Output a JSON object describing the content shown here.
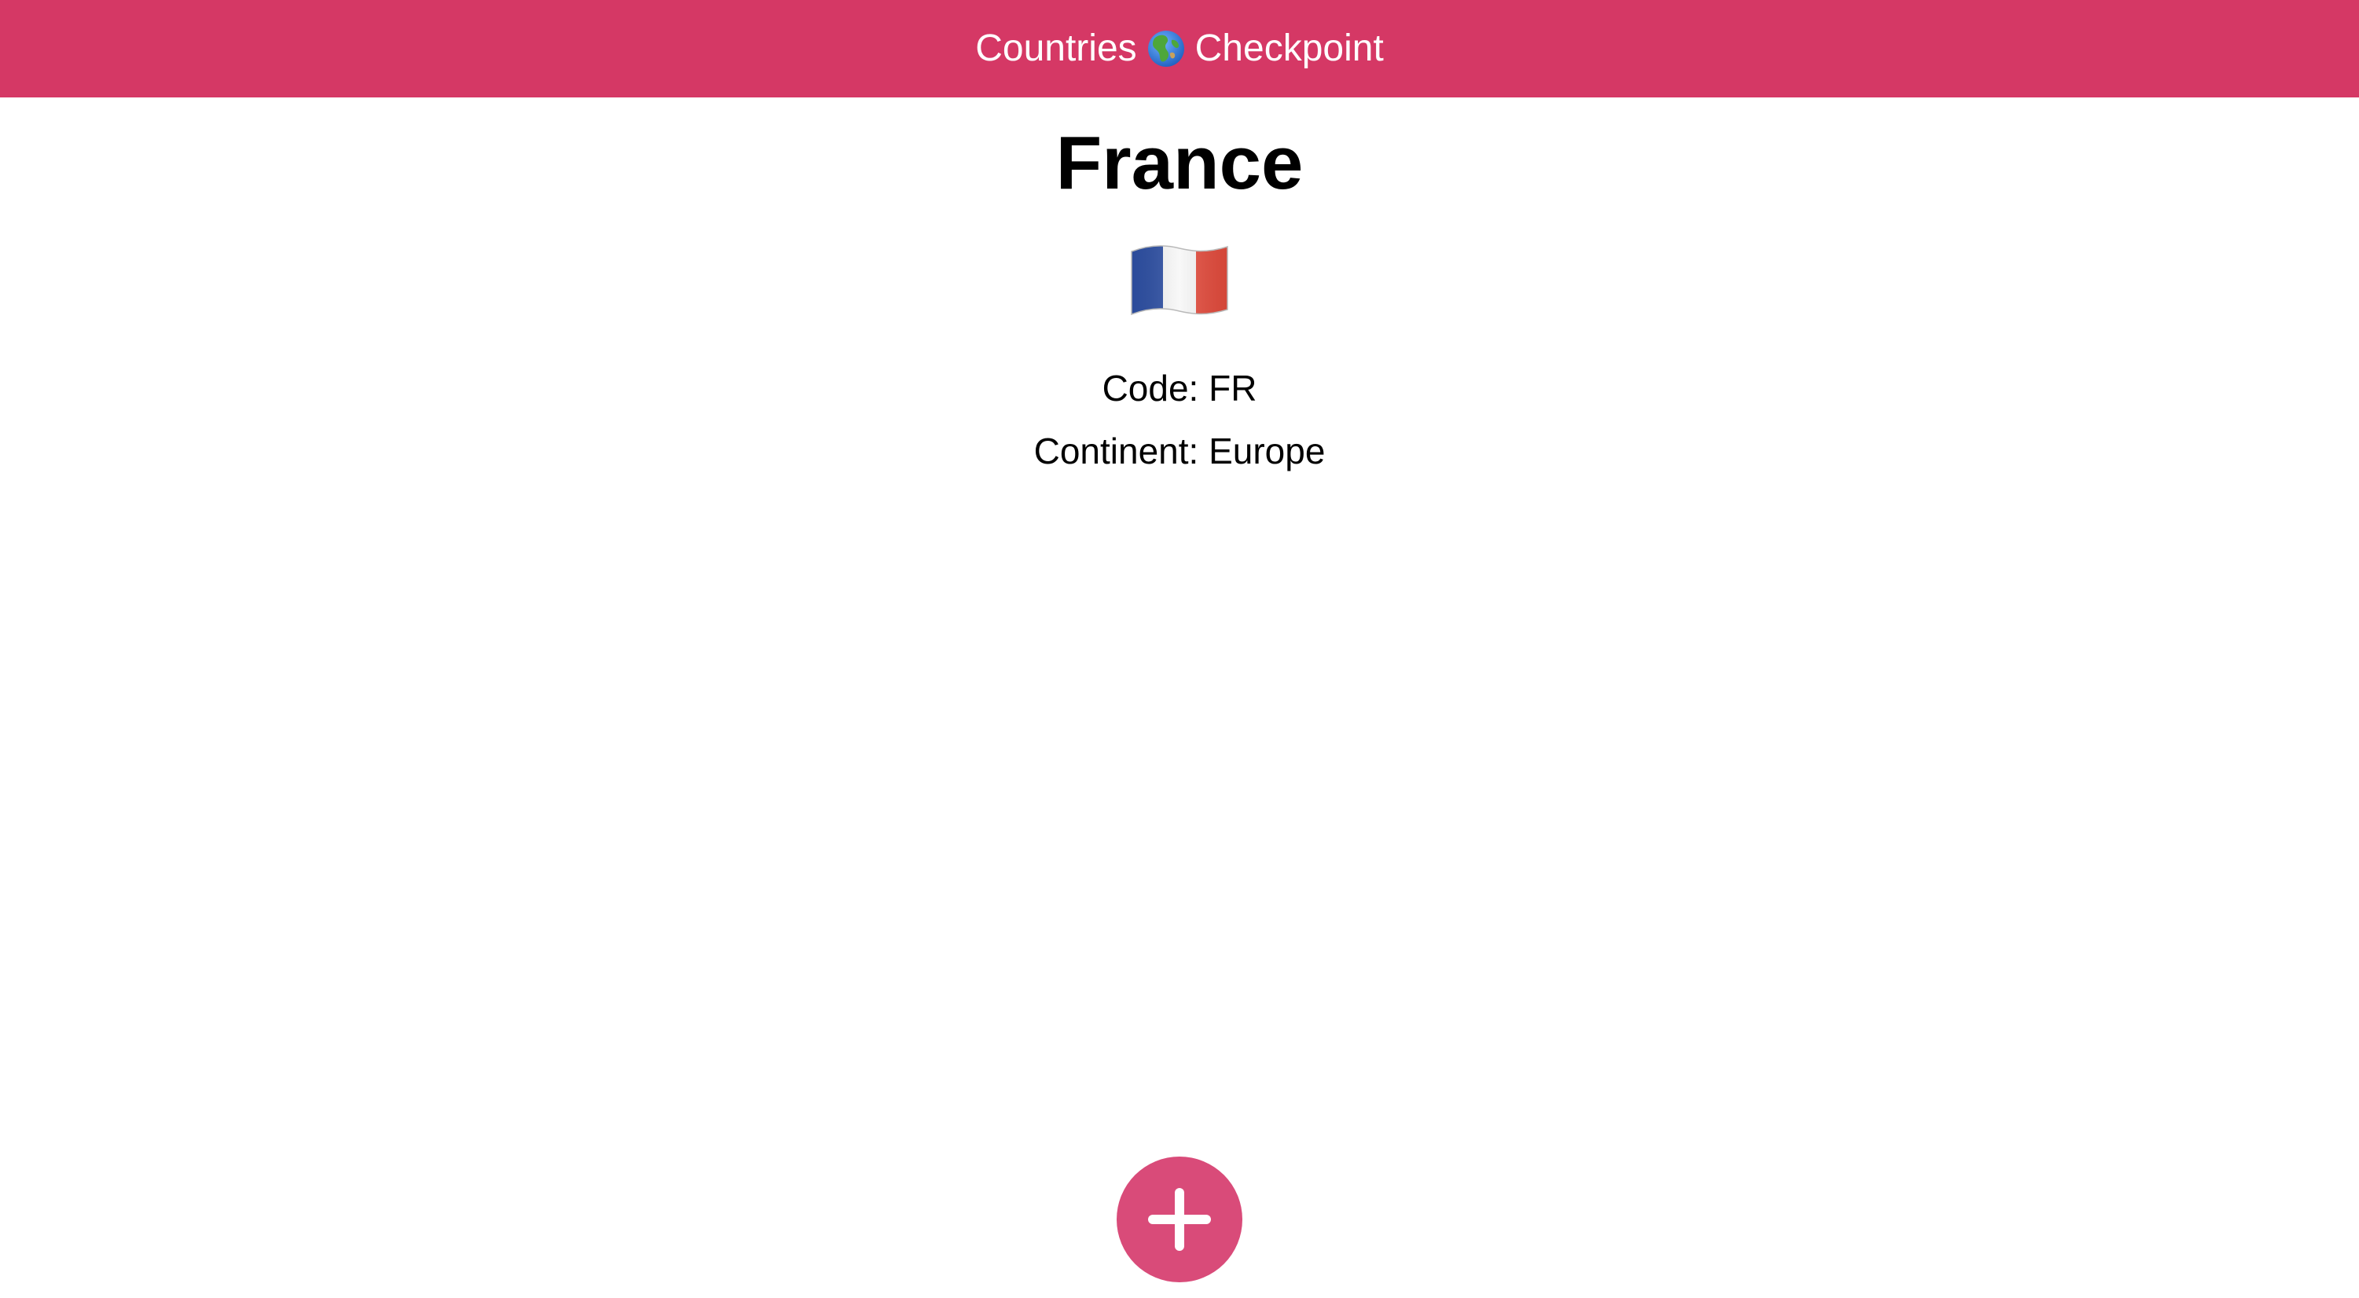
{
  "header": {
    "title_before": "Countries",
    "title_after": "Checkpoint",
    "background": "#d53865",
    "icon": "globe-icon"
  },
  "country": {
    "name": "France",
    "flag_icon": "france-flag-icon",
    "code_label": "Code: FR",
    "continent_label": "Continent: Europe"
  },
  "fab": {
    "icon": "plus-icon",
    "color": "#d94b79"
  }
}
